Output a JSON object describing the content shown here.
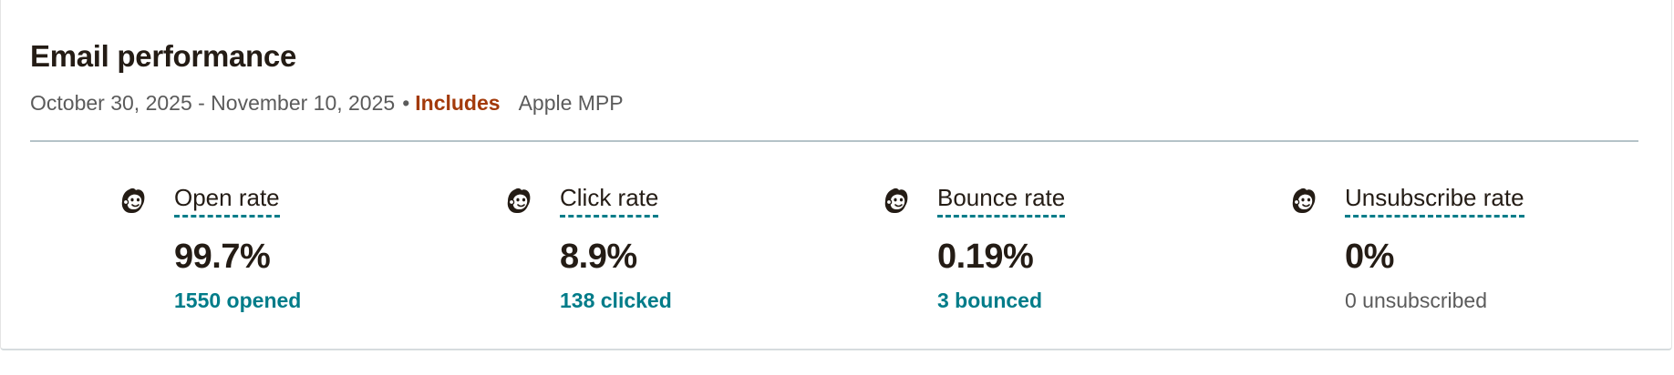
{
  "header": {
    "title": "Email performance",
    "date_range": "October 30, 2025 - November 10, 2025",
    "bullet": "•",
    "includes_label": "Includes",
    "includes_value": "Apple MPP"
  },
  "metrics": [
    {
      "icon": "mailchimp-freddie-icon",
      "label": "Open rate",
      "value": "99.7%",
      "detail": "1550 opened"
    },
    {
      "icon": "mailchimp-freddie-icon",
      "label": "Click rate",
      "value": "8.9%",
      "detail": "138 clicked"
    },
    {
      "icon": "mailchimp-freddie-icon",
      "label": "Bounce rate",
      "value": "0.19%",
      "detail": "3 bounced"
    },
    {
      "icon": "mailchimp-freddie-icon",
      "label": "Unsubscribe rate",
      "value": "0%",
      "detail": "0 unsubscribed"
    }
  ],
  "colors": {
    "accent_teal": "#007c89",
    "includes_orange": "#a33a0a",
    "text_dark": "#241c15",
    "text_muted": "#5b5b5b",
    "divider": "#b5c3c8"
  }
}
